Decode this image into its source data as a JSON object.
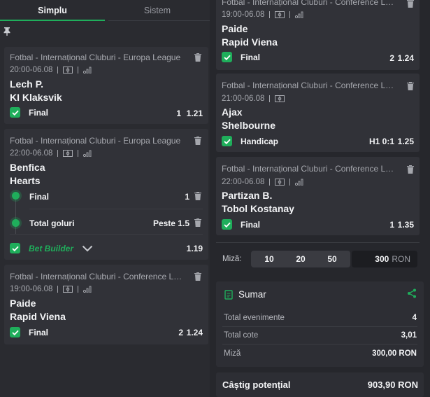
{
  "tabs": {
    "simplu": "Simplu",
    "sistem": "Sistem"
  },
  "left": {
    "card1": {
      "league": "Fotbal - Internațional Cluburi - Europa League",
      "time": "20:00-06.08",
      "home": "Lech P.",
      "away": "KI Klaksvik",
      "market": "Final",
      "selection": "1",
      "odds": "1.21"
    },
    "card2": {
      "league": "Fotbal - Internațional Cluburi - Europa League",
      "time": "22:00-06.08",
      "home": "Benfica",
      "away": "Hearts",
      "leg1": {
        "market": "Final",
        "selection": "1"
      },
      "leg2": {
        "market": "Total goluri",
        "selection": "Peste 1.5"
      },
      "builder_label": "Bet Builder",
      "odds": "1.19"
    },
    "card3": {
      "league": "Fotbal - Internațional Cluburi - Conference League",
      "time": "19:00-06.08",
      "home": "Paide",
      "away": "Rapid Viena",
      "market": "Final",
      "selection": "2",
      "odds": "1.24"
    }
  },
  "right": {
    "card1": {
      "league": "Fotbal - Internațional Cluburi - Conference League",
      "time": "19:00-06.08",
      "home": "Paide",
      "away": "Rapid Viena",
      "market": "Final",
      "selection": "2",
      "odds": "1.24"
    },
    "card2": {
      "league": "Fotbal - Internațional Cluburi - Conference League",
      "time": "21:00-06.08",
      "home": "Ajax",
      "away": "Shelbourne",
      "market": "Handicap",
      "selection": "H1 0:1",
      "odds": "1.25"
    },
    "card3": {
      "league": "Fotbal - Internațional Cluburi - Conference League",
      "time": "22:00-06.08",
      "home": "Partizan B.",
      "away": "Tobol Kostanay",
      "market": "Final",
      "selection": "1",
      "odds": "1.35"
    }
  },
  "stake": {
    "label": "Miză:",
    "chips": [
      "10",
      "20",
      "50"
    ],
    "amount": "300",
    "currency": "RON"
  },
  "summary": {
    "title": "Sumar",
    "rows": [
      {
        "label": "Total evenimente",
        "value": "4"
      },
      {
        "label": "Total cote",
        "value": "3,01"
      },
      {
        "label": "Miză",
        "value": "300,00 RON"
      }
    ]
  },
  "potential": {
    "label": "Câștig potențial",
    "value": "903,90 RON"
  },
  "colors": {
    "accent": "#1fae5b",
    "panel": "#2a2b30",
    "card": "#313238"
  }
}
